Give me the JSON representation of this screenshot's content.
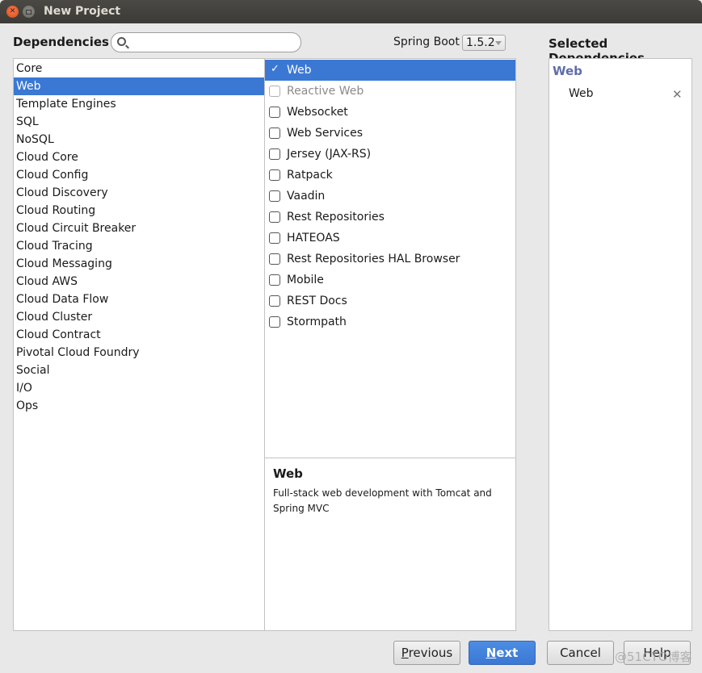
{
  "window": {
    "title": "New Project",
    "controls": [
      "close",
      "maximize"
    ]
  },
  "header": {
    "dependencies_label": "Dependencies",
    "search": {
      "value": "",
      "placeholder": "",
      "icon": "search-icon"
    },
    "spring_boot_label": "Spring Boot",
    "spring_boot_version": "1.5.2",
    "selected_label": "Selected Dependencies"
  },
  "categories": {
    "selected": "Web",
    "items": [
      {
        "label": "Core"
      },
      {
        "label": "Web"
      },
      {
        "label": "Template Engines"
      },
      {
        "label": "SQL"
      },
      {
        "label": "NoSQL"
      },
      {
        "label": "Cloud Core"
      },
      {
        "label": "Cloud Config"
      },
      {
        "label": "Cloud Discovery"
      },
      {
        "label": "Cloud Routing"
      },
      {
        "label": "Cloud Circuit Breaker"
      },
      {
        "label": "Cloud Tracing"
      },
      {
        "label": "Cloud Messaging"
      },
      {
        "label": "Cloud AWS"
      },
      {
        "label": "Cloud Data Flow"
      },
      {
        "label": "Cloud Cluster"
      },
      {
        "label": "Cloud Contract"
      },
      {
        "label": "Pivotal Cloud Foundry"
      },
      {
        "label": "Social"
      },
      {
        "label": "I/O"
      },
      {
        "label": "Ops"
      }
    ]
  },
  "dependencies": {
    "items": [
      {
        "label": "Web",
        "checked": true,
        "selected": true,
        "disabled": false
      },
      {
        "label": "Reactive Web",
        "checked": false,
        "selected": false,
        "disabled": true
      },
      {
        "label": "Websocket",
        "checked": false,
        "selected": false,
        "disabled": false
      },
      {
        "label": "Web Services",
        "checked": false,
        "selected": false,
        "disabled": false
      },
      {
        "label": "Jersey (JAX-RS)",
        "checked": false,
        "selected": false,
        "disabled": false
      },
      {
        "label": "Ratpack",
        "checked": false,
        "selected": false,
        "disabled": false
      },
      {
        "label": "Vaadin",
        "checked": false,
        "selected": false,
        "disabled": false
      },
      {
        "label": "Rest Repositories",
        "checked": false,
        "selected": false,
        "disabled": false
      },
      {
        "label": "HATEOAS",
        "checked": false,
        "selected": false,
        "disabled": false
      },
      {
        "label": "Rest Repositories HAL Browser",
        "checked": false,
        "selected": false,
        "disabled": false
      },
      {
        "label": "Mobile",
        "checked": false,
        "selected": false,
        "disabled": false
      },
      {
        "label": "REST Docs",
        "checked": false,
        "selected": false,
        "disabled": false
      },
      {
        "label": "Stormpath",
        "checked": false,
        "selected": false,
        "disabled": false
      }
    ]
  },
  "description": {
    "title": "Web",
    "text": "Full-stack web development with Tomcat and Spring MVC"
  },
  "selected_dependencies": {
    "group": "Web",
    "items": [
      {
        "label": "Web",
        "remove_icon": "close-icon"
      }
    ]
  },
  "footer": {
    "previous": {
      "mnemonic": "P",
      "rest": "revious"
    },
    "next": {
      "mnemonic": "N",
      "rest": "ext"
    },
    "cancel": "Cancel",
    "help": "Help"
  },
  "watermark": "@51CTO博客",
  "colors": {
    "selection": "#3a78d4",
    "group_heading": "#5f6ea8",
    "titlebar": "#3c3b37",
    "close_button": "#df4a16"
  }
}
